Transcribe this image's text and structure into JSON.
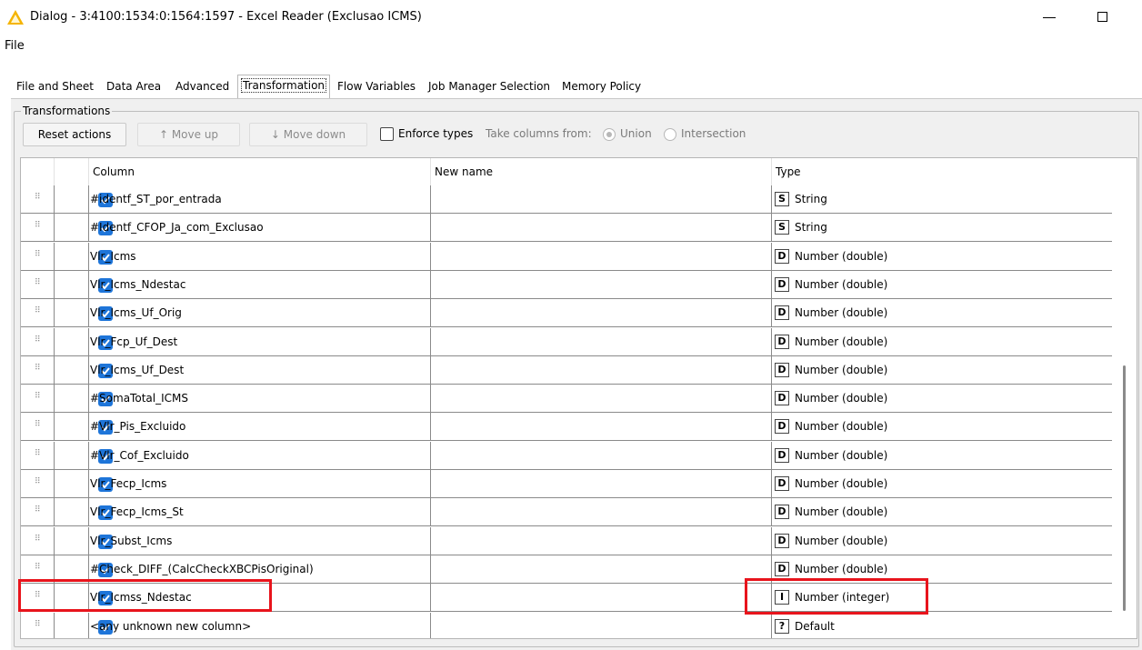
{
  "window": {
    "title": "Dialog - 3:4100:1534:0:1564:1597 - Excel Reader (Exclusao ICMS)",
    "icon": "warning-triangle-icon"
  },
  "menu": {
    "file": "File"
  },
  "tabs": [
    {
      "label": "File and Sheet"
    },
    {
      "label": "Data Area"
    },
    {
      "label": "Advanced"
    },
    {
      "label": "Transformation",
      "active": true
    },
    {
      "label": "Flow Variables"
    },
    {
      "label": "Job Manager Selection"
    },
    {
      "label": "Memory Policy"
    }
  ],
  "transformations": {
    "group_title": "Transformations",
    "reset_label": "Reset actions",
    "move_up_label": "Move up",
    "move_down_label": "Move down",
    "enforce_types_label": "Enforce types",
    "take_columns_label": "Take columns from:",
    "union_label": "Union",
    "intersection_label": "Intersection",
    "take_columns_selected": "Union"
  },
  "table": {
    "headers": {
      "column": "Column",
      "new_name": "New name",
      "type": "Type"
    },
    "rows": [
      {
        "column": "#identf_ST_por_entrada",
        "new_name": "",
        "type_badge": "S",
        "type": "String",
        "checked": true
      },
      {
        "column": "#Identf_CFOP_Ja_com_Exclusao",
        "new_name": "",
        "type_badge": "S",
        "type": "String",
        "checked": true
      },
      {
        "column": "Vlr_Icms",
        "new_name": "",
        "type_badge": "D",
        "type": "Number (double)",
        "checked": true
      },
      {
        "column": "Vlr_Icms_Ndestac",
        "new_name": "",
        "type_badge": "D",
        "type": "Number (double)",
        "checked": true
      },
      {
        "column": "Vlr_Icms_Uf_Orig",
        "new_name": "",
        "type_badge": "D",
        "type": "Number (double)",
        "checked": true
      },
      {
        "column": "Vlr_Fcp_Uf_Dest",
        "new_name": "",
        "type_badge": "D",
        "type": "Number (double)",
        "checked": true
      },
      {
        "column": "Vlr_Icms_Uf_Dest",
        "new_name": "",
        "type_badge": "D",
        "type": "Number (double)",
        "checked": true
      },
      {
        "column": "#SomaTotal_ICMS",
        "new_name": "",
        "type_badge": "D",
        "type": "Number (double)",
        "checked": true
      },
      {
        "column": "#Vlr_Pis_Excluido",
        "new_name": "",
        "type_badge": "D",
        "type": "Number (double)",
        "checked": true
      },
      {
        "column": "#Vlr_Cof_Excluido",
        "new_name": "",
        "type_badge": "D",
        "type": "Number (double)",
        "checked": true
      },
      {
        "column": "Vlr_Fecp_Icms",
        "new_name": "",
        "type_badge": "D",
        "type": "Number (double)",
        "checked": true
      },
      {
        "column": "Vlr_Fecp_Icms_St",
        "new_name": "",
        "type_badge": "D",
        "type": "Number (double)",
        "checked": true
      },
      {
        "column": "Vlr_Subst_Icms",
        "new_name": "",
        "type_badge": "D",
        "type": "Number (double)",
        "checked": true
      },
      {
        "column": "#Check_DIFF_(CalcCheckXBCPisOriginal)",
        "new_name": "",
        "type_badge": "D",
        "type": "Number (double)",
        "checked": true
      },
      {
        "column": "Vlr_Icmss_Ndestac",
        "new_name": "",
        "type_badge": "I",
        "type": "Number (integer)",
        "checked": true
      },
      {
        "column": "<any unknown new column>",
        "new_name": "",
        "type_badge": "?",
        "type": "Default",
        "checked": true
      }
    ]
  },
  "colors": {
    "checkbox": "#1e75d9",
    "highlight": "#e8141c",
    "warning": "#f5b400"
  }
}
